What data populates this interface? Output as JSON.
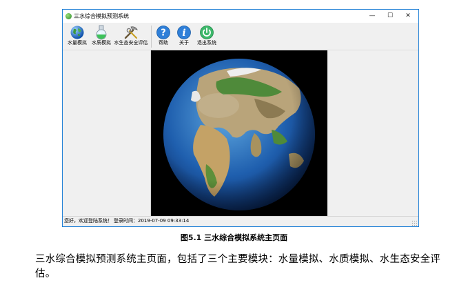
{
  "window": {
    "title": "三水综合模拟预测系统",
    "controls": {
      "minimize": "—",
      "maximize": "☐",
      "close": "✕"
    }
  },
  "toolbar": {
    "items": [
      {
        "label": "水量模拟",
        "icon": "globe-icon"
      },
      {
        "label": "水质模拟",
        "icon": "flask-icon"
      },
      {
        "label": "水生态安全评估",
        "icon": "tools-icon"
      },
      {
        "label": "帮助",
        "icon": "help-icon"
      },
      {
        "label": "关于",
        "icon": "info-icon"
      },
      {
        "label": "退出系统",
        "icon": "power-icon"
      }
    ]
  },
  "viewer": {
    "image": "earth-globe"
  },
  "status_bar": {
    "greeting": "您好，欢迎登陆系统！",
    "login_time": "登录时间：2019-07-09 09:33:14"
  },
  "caption": "图5.1 三水综合模拟系统主页面",
  "body_text": "三水综合模拟预测系统主页面，包括了三个主要模块：水量模拟、水质模拟、水生态安全评估。",
  "colors": {
    "window_border": "#1e7fd6",
    "chrome_bg": "#f0f0f0",
    "viewer_bg": "#000000"
  }
}
